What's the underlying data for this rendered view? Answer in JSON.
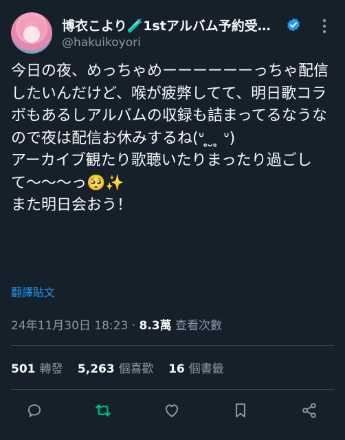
{
  "author": {
    "display_name": "博衣こより🧪1stアルバム予約受付…",
    "handle": "@hakuikoyori"
  },
  "tweet": {
    "text": "今日の夜、めっちゃめーーーーーーっちゃ配信したいんだけど、喉が疲弊してて、明日歌コラボもあるしアルバムの収録も詰まってるなうなので夜は配信お休みするね(ᐡ ̥ ̮ ̥ ᐡ)\nアーカイブ観たり歌聴いたりまったり過ごして〜〜〜っ🥺✨\nまた明日会おう！",
    "translate_label": "翻譯貼文"
  },
  "meta": {
    "timestamp": "24年11月30日 18:23",
    "separator": " · ",
    "views_count": "8.3萬",
    "views_label": " 查看次數"
  },
  "stats": {
    "retweets_count": "501",
    "retweets_label": "轉發",
    "likes_count": "5,263",
    "likes_label": "個喜歡",
    "bookmarks_count": "16",
    "bookmarks_label": "個書籤"
  },
  "colors": {
    "background": "#15202b",
    "text": "#f7f9f9",
    "secondary": "#8b98a5",
    "accent": "#1d9bf0",
    "retweet_active": "#00ba7c",
    "divider": "#38444d"
  },
  "icons": {
    "verified": "verified-badge-icon",
    "more": "more-options-icon",
    "reply": "reply-icon",
    "retweet": "retweet-icon",
    "like": "heart-icon",
    "bookmark": "bookmark-icon",
    "share": "share-icon"
  }
}
